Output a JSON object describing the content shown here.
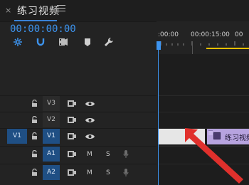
{
  "tab": {
    "close": "×",
    "title": "练习视频"
  },
  "timecode": "00:00:00:00",
  "ruler": {
    "labels": [
      ":00:00",
      "00:00:15:00",
      "00"
    ]
  },
  "tracks": {
    "video": [
      {
        "name": "V3",
        "source": ""
      },
      {
        "name": "V2",
        "source": ""
      },
      {
        "name": "V1",
        "source": "V1"
      }
    ],
    "audio": [
      {
        "name": "A1",
        "m": "M",
        "s": "S"
      },
      {
        "name": "A2",
        "m": "M",
        "s": "S"
      }
    ]
  },
  "clip": {
    "label": "练习视频"
  },
  "colors": {
    "accent": "#3d94ef",
    "target_blue": "#1f4f84",
    "clip_purple": "#b7a3df",
    "in_out_yellow": "#e7c000",
    "arrow_red": "#e0302c"
  }
}
